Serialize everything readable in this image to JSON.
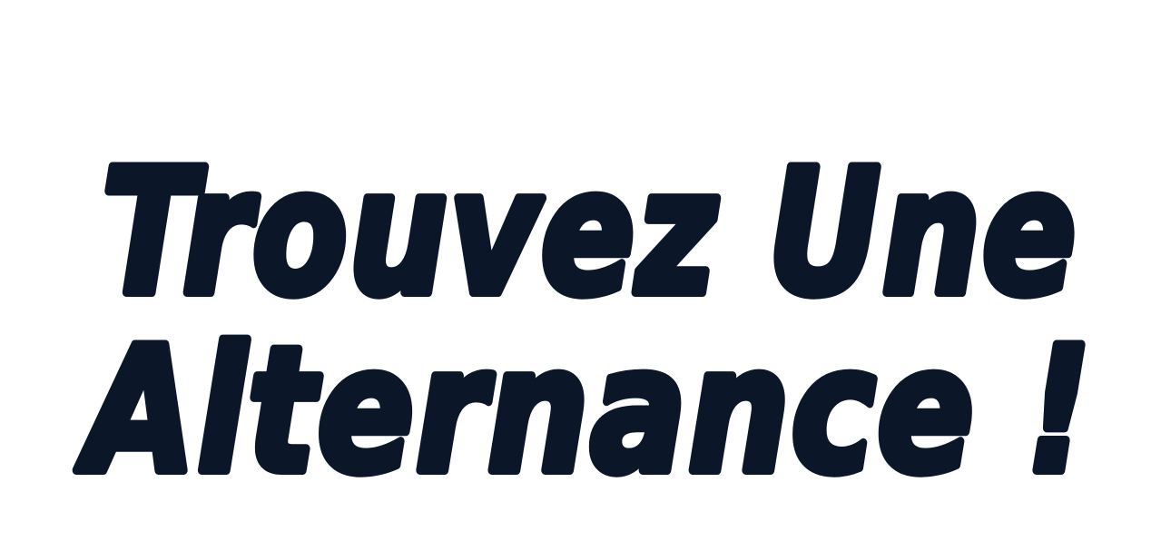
{
  "headline": {
    "line1": "Trouvez Une",
    "line2": "Alternance !"
  },
  "colors": {
    "background": "#ffffff",
    "text": "#0b1729"
  }
}
